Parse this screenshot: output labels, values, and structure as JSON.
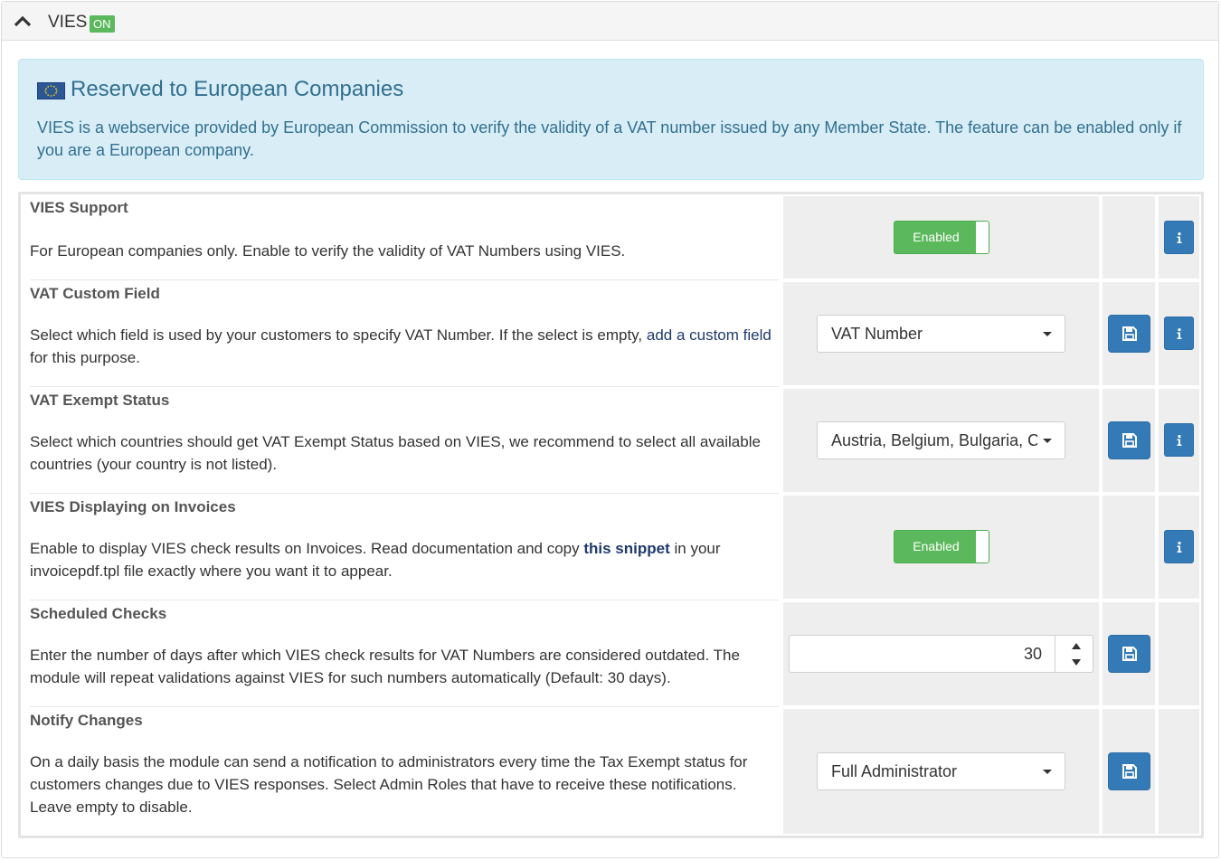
{
  "header": {
    "title": "VIES",
    "badge": "ON"
  },
  "notice": {
    "title": "Reserved to European Companies",
    "text": "VIES is a webservice provided by European Commission to verify the validity of a VAT number issued by any Member State. The feature can be enabled only if you are a European company."
  },
  "settings": [
    {
      "title": "VIES Support",
      "desc": "For European companies only. Enable to verify the validity of VAT Numbers using VIES.",
      "toggle": "Enabled"
    },
    {
      "title": "VAT Custom Field",
      "desc_before": "Select which field is used by your customers to specify VAT Number. If the select is empty, ",
      "desc_link": "add a custom field",
      "desc_after": " for this purpose.",
      "select": "VAT Number"
    },
    {
      "title": "VAT Exempt Status",
      "desc": "Select which countries should get VAT Exempt Status based on VIES, we recommend to select all available countries (your country is not listed).",
      "select": "Austria, Belgium, Bulgaria, Croatia, Cyprus"
    },
    {
      "title": "VIES Displaying on Invoices",
      "desc_before": "Enable to display VIES check results on Invoices. Read documentation and copy ",
      "desc_link": "this snippet",
      "desc_after": " in your invoicepdf.tpl file exactly where you want it to appear.",
      "toggle": "Enabled"
    },
    {
      "title": "Scheduled Checks",
      "desc": "Enter the number of days after which VIES check results for VAT Numbers are considered outdated. The module will repeat validations against VIES for such numbers automatically (Default: 30 days).",
      "number": "30"
    },
    {
      "title": "Notify Changes",
      "desc": "On a daily basis the module can send a notification to administrators every time the Tax Exempt status for customers changes due to VIES responses. Select Admin Roles that have to receive these notifications. Leave empty to disable.",
      "select": "Full Administrator"
    }
  ]
}
